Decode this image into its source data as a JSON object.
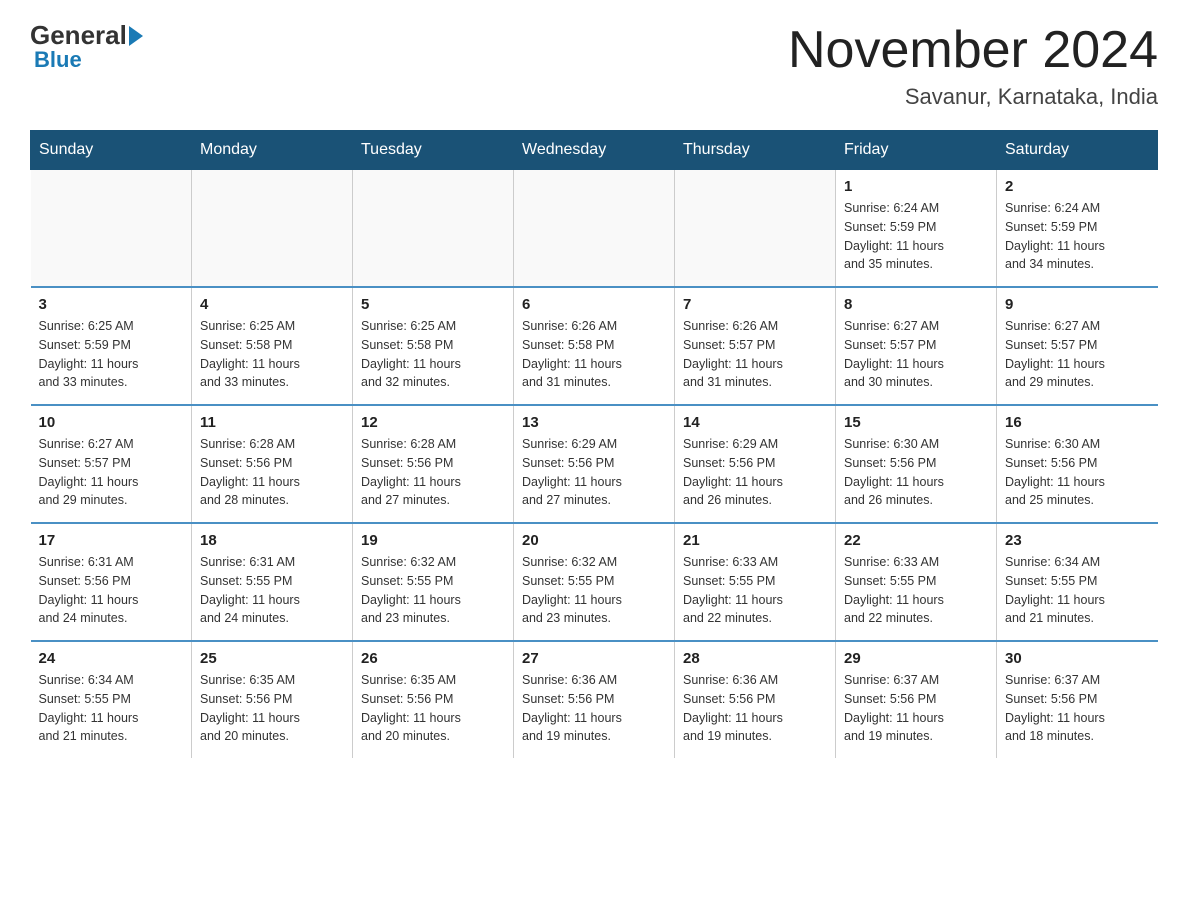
{
  "logo": {
    "general_text": "General",
    "blue_text": "Blue"
  },
  "header": {
    "month_year": "November 2024",
    "location": "Savanur, Karnataka, India"
  },
  "days_of_week": [
    "Sunday",
    "Monday",
    "Tuesday",
    "Wednesday",
    "Thursday",
    "Friday",
    "Saturday"
  ],
  "weeks": [
    [
      {
        "day": "",
        "info": ""
      },
      {
        "day": "",
        "info": ""
      },
      {
        "day": "",
        "info": ""
      },
      {
        "day": "",
        "info": ""
      },
      {
        "day": "",
        "info": ""
      },
      {
        "day": "1",
        "info": "Sunrise: 6:24 AM\nSunset: 5:59 PM\nDaylight: 11 hours\nand 35 minutes."
      },
      {
        "day": "2",
        "info": "Sunrise: 6:24 AM\nSunset: 5:59 PM\nDaylight: 11 hours\nand 34 minutes."
      }
    ],
    [
      {
        "day": "3",
        "info": "Sunrise: 6:25 AM\nSunset: 5:59 PM\nDaylight: 11 hours\nand 33 minutes."
      },
      {
        "day": "4",
        "info": "Sunrise: 6:25 AM\nSunset: 5:58 PM\nDaylight: 11 hours\nand 33 minutes."
      },
      {
        "day": "5",
        "info": "Sunrise: 6:25 AM\nSunset: 5:58 PM\nDaylight: 11 hours\nand 32 minutes."
      },
      {
        "day": "6",
        "info": "Sunrise: 6:26 AM\nSunset: 5:58 PM\nDaylight: 11 hours\nand 31 minutes."
      },
      {
        "day": "7",
        "info": "Sunrise: 6:26 AM\nSunset: 5:57 PM\nDaylight: 11 hours\nand 31 minutes."
      },
      {
        "day": "8",
        "info": "Sunrise: 6:27 AM\nSunset: 5:57 PM\nDaylight: 11 hours\nand 30 minutes."
      },
      {
        "day": "9",
        "info": "Sunrise: 6:27 AM\nSunset: 5:57 PM\nDaylight: 11 hours\nand 29 minutes."
      }
    ],
    [
      {
        "day": "10",
        "info": "Sunrise: 6:27 AM\nSunset: 5:57 PM\nDaylight: 11 hours\nand 29 minutes."
      },
      {
        "day": "11",
        "info": "Sunrise: 6:28 AM\nSunset: 5:56 PM\nDaylight: 11 hours\nand 28 minutes."
      },
      {
        "day": "12",
        "info": "Sunrise: 6:28 AM\nSunset: 5:56 PM\nDaylight: 11 hours\nand 27 minutes."
      },
      {
        "day": "13",
        "info": "Sunrise: 6:29 AM\nSunset: 5:56 PM\nDaylight: 11 hours\nand 27 minutes."
      },
      {
        "day": "14",
        "info": "Sunrise: 6:29 AM\nSunset: 5:56 PM\nDaylight: 11 hours\nand 26 minutes."
      },
      {
        "day": "15",
        "info": "Sunrise: 6:30 AM\nSunset: 5:56 PM\nDaylight: 11 hours\nand 26 minutes."
      },
      {
        "day": "16",
        "info": "Sunrise: 6:30 AM\nSunset: 5:56 PM\nDaylight: 11 hours\nand 25 minutes."
      }
    ],
    [
      {
        "day": "17",
        "info": "Sunrise: 6:31 AM\nSunset: 5:56 PM\nDaylight: 11 hours\nand 24 minutes."
      },
      {
        "day": "18",
        "info": "Sunrise: 6:31 AM\nSunset: 5:55 PM\nDaylight: 11 hours\nand 24 minutes."
      },
      {
        "day": "19",
        "info": "Sunrise: 6:32 AM\nSunset: 5:55 PM\nDaylight: 11 hours\nand 23 minutes."
      },
      {
        "day": "20",
        "info": "Sunrise: 6:32 AM\nSunset: 5:55 PM\nDaylight: 11 hours\nand 23 minutes."
      },
      {
        "day": "21",
        "info": "Sunrise: 6:33 AM\nSunset: 5:55 PM\nDaylight: 11 hours\nand 22 minutes."
      },
      {
        "day": "22",
        "info": "Sunrise: 6:33 AM\nSunset: 5:55 PM\nDaylight: 11 hours\nand 22 minutes."
      },
      {
        "day": "23",
        "info": "Sunrise: 6:34 AM\nSunset: 5:55 PM\nDaylight: 11 hours\nand 21 minutes."
      }
    ],
    [
      {
        "day": "24",
        "info": "Sunrise: 6:34 AM\nSunset: 5:55 PM\nDaylight: 11 hours\nand 21 minutes."
      },
      {
        "day": "25",
        "info": "Sunrise: 6:35 AM\nSunset: 5:56 PM\nDaylight: 11 hours\nand 20 minutes."
      },
      {
        "day": "26",
        "info": "Sunrise: 6:35 AM\nSunset: 5:56 PM\nDaylight: 11 hours\nand 20 minutes."
      },
      {
        "day": "27",
        "info": "Sunrise: 6:36 AM\nSunset: 5:56 PM\nDaylight: 11 hours\nand 19 minutes."
      },
      {
        "day": "28",
        "info": "Sunrise: 6:36 AM\nSunset: 5:56 PM\nDaylight: 11 hours\nand 19 minutes."
      },
      {
        "day": "29",
        "info": "Sunrise: 6:37 AM\nSunset: 5:56 PM\nDaylight: 11 hours\nand 19 minutes."
      },
      {
        "day": "30",
        "info": "Sunrise: 6:37 AM\nSunset: 5:56 PM\nDaylight: 11 hours\nand 18 minutes."
      }
    ]
  ]
}
